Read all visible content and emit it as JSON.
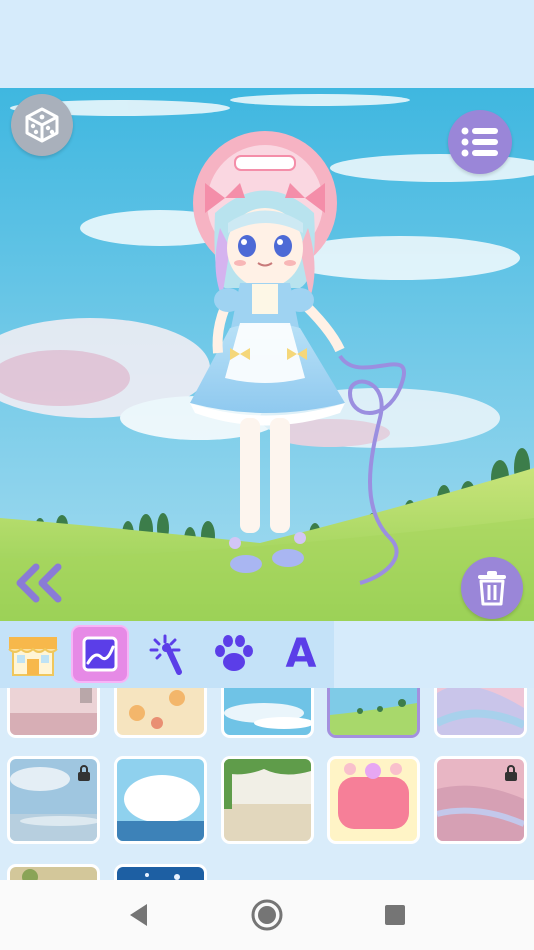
{
  "toolbar": {
    "random_button": "dice-icon",
    "menu_button": "list-icon",
    "delete_button": "trash-icon",
    "collapse_button": "double-chevron-left-icon"
  },
  "tabs": [
    {
      "name": "shop",
      "icon": "shop-icon",
      "selected": false
    },
    {
      "name": "background",
      "icon": "image-frame-icon",
      "selected": true
    },
    {
      "name": "effects",
      "icon": "magic-wand-icon",
      "selected": false
    },
    {
      "name": "pets",
      "icon": "paw-icon",
      "selected": false
    },
    {
      "name": "text",
      "icon": "letter-a-icon",
      "selected": false
    }
  ],
  "tab_text_glyph": "A",
  "backgrounds": [
    {
      "id": "bg-1",
      "theme": "pink-room",
      "locked": false,
      "selected": false
    },
    {
      "id": "bg-2",
      "theme": "cream-pattern",
      "locked": false,
      "selected": false
    },
    {
      "id": "bg-3",
      "theme": "blue-sky",
      "locked": false,
      "selected": false
    },
    {
      "id": "bg-4",
      "theme": "green-hills",
      "locked": false,
      "selected": true
    },
    {
      "id": "bg-5",
      "theme": "pastel-marble",
      "locked": false,
      "selected": false
    },
    {
      "id": "bg-6",
      "theme": "cloudy-sky",
      "locked": true,
      "selected": false
    },
    {
      "id": "bg-7",
      "theme": "sea-clouds",
      "locked": false,
      "selected": false
    },
    {
      "id": "bg-8",
      "theme": "brick-wall-vines",
      "locked": false,
      "selected": false
    },
    {
      "id": "bg-9",
      "theme": "pink-frame-moon",
      "locked": false,
      "selected": false
    },
    {
      "id": "bg-10",
      "theme": "pink-haze",
      "locked": true,
      "selected": false
    },
    {
      "id": "bg-11",
      "theme": "garden",
      "locked": false,
      "selected": false
    },
    {
      "id": "bg-12",
      "theme": "night-sky",
      "locked": false,
      "selected": false
    }
  ],
  "navbar": {
    "back": "back-triangle-icon",
    "home": "home-circle-icon",
    "recents": "recents-square-icon"
  },
  "colors": {
    "accent": "#9a86d8",
    "selected_tab": "#e68ae6",
    "panel": "#d9ecfa",
    "tab_icon": "#5b3ee8"
  }
}
